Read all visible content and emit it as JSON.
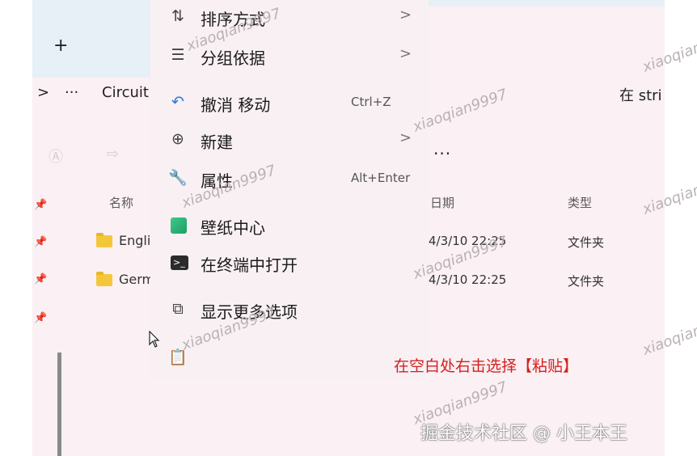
{
  "explorer": {
    "new_tab_label": "+",
    "breadcrumb_chevron": ">",
    "breadcrumb_more": "···",
    "breadcrumb_folder": "Circuit",
    "search_placeholder": "在 stri",
    "toolbar_more": "···",
    "columns": {
      "name": "名称",
      "date": "日期",
      "type": "类型"
    },
    "rows": [
      {
        "name": "Engli",
        "date": "4/3/10 22:25",
        "type": "文件夹"
      },
      {
        "name": "Germ",
        "date": "4/3/10 22:25",
        "type": "文件夹"
      }
    ]
  },
  "context_menu": {
    "items": [
      {
        "label": "排序方式",
        "shortcut": "",
        "arrow": ">",
        "icon": "sort-icon"
      },
      {
        "label": "分组依据",
        "shortcut": "",
        "arrow": ">",
        "icon": "group-icon"
      },
      {
        "label": "撤消 移动",
        "shortcut": "Ctrl+Z",
        "arrow": "",
        "icon": "undo-icon"
      },
      {
        "label": "新建",
        "shortcut": "",
        "arrow": ">",
        "icon": "new-icon"
      },
      {
        "label": "属性",
        "shortcut": "Alt+Enter",
        "arrow": "",
        "icon": "wrench-icon"
      },
      {
        "label": "壁纸中心",
        "shortcut": "",
        "arrow": "",
        "icon": "wallpaper-icon"
      },
      {
        "label": "在终端中打开",
        "shortcut": "",
        "arrow": "",
        "icon": "terminal-icon"
      },
      {
        "label": "显示更多选项",
        "shortcut": "",
        "arrow": "",
        "icon": "more-options-icon"
      }
    ]
  },
  "annotation": "在空白处右击选择【粘贴】",
  "watermark": "xiaoqian9997",
  "credit": "掘金技术社区 @ 小王本王"
}
